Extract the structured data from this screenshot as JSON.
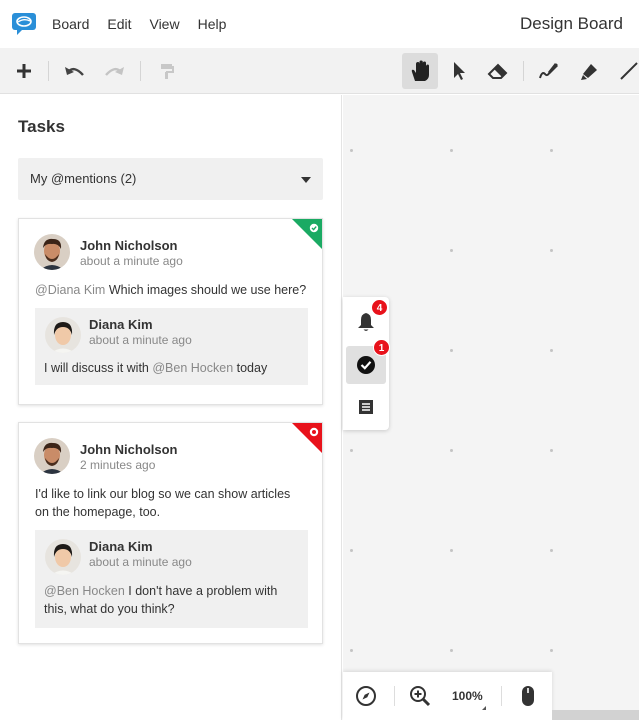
{
  "menubar": {
    "logo_icon": "speech-bubble-logo-icon",
    "items": [
      "Board",
      "Edit",
      "View",
      "Help"
    ],
    "board_title": "Design Board"
  },
  "toolbar": {
    "tools": [
      "add-icon",
      "undo-icon",
      "redo-icon",
      "format-painter-icon",
      "hand-icon",
      "pointer-icon",
      "eraser-icon",
      "pen-icon",
      "highlighter-icon",
      "line-icon"
    ],
    "active_tool": "hand-icon"
  },
  "panel": {
    "title": "Tasks",
    "filter": "My @mentions (2)",
    "cards": [
      {
        "status": "resolved",
        "status_color": "#1aaa63",
        "author": "John Nicholson",
        "time": "about a minute ago",
        "mention": "@Diana Kim",
        "text": " Which images should we use here?",
        "reply": {
          "author": "Diana Kim",
          "time": "about a minute ago",
          "text_before": "I will discuss it with ",
          "mention": "@Ben Hocken",
          "text_after": " today"
        }
      },
      {
        "status": "open",
        "status_color": "#e8121b",
        "author": "John Nicholson",
        "time": "2 minutes ago",
        "text_line1": "I'd like to link our blog so we can show articles",
        "text_line2": "on the homepage, too.",
        "reply": {
          "author": "Diana Kim",
          "time": "about a minute ago",
          "mention": "@Ben Hocken",
          "text_line1": " I don't have a problem with",
          "text_line2": "this, what do you think?"
        }
      }
    ]
  },
  "side_tools": {
    "notifications": {
      "icon": "bell-icon",
      "badge": "4"
    },
    "tasks": {
      "icon": "check-circle-icon",
      "badge": "1"
    },
    "notes": {
      "icon": "list-icon"
    }
  },
  "zoom": {
    "level": "100%",
    "icons": [
      "compass-icon",
      "zoom-in-icon",
      "mouse-icon"
    ]
  },
  "colors": {
    "accent": "#2a8fd8",
    "badge": "#e8121b",
    "resolved": "#1aaa63"
  }
}
